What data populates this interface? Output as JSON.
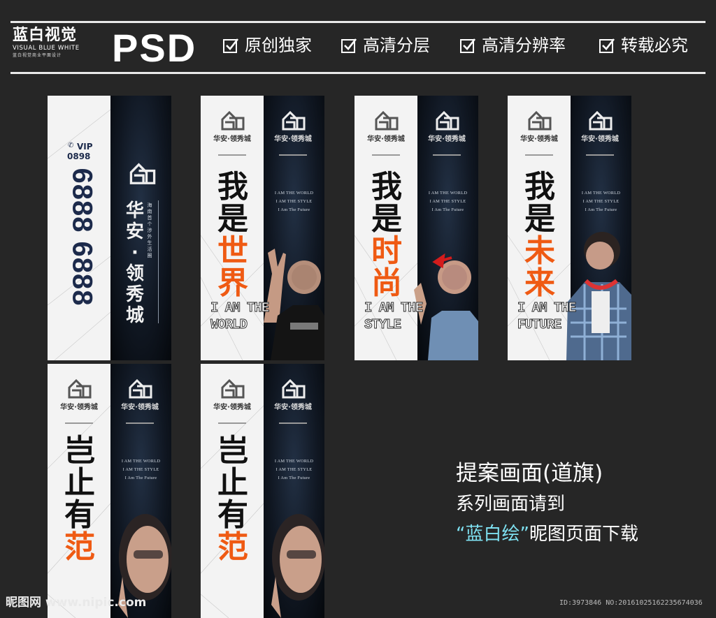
{
  "header": {
    "brand_title": "蓝白视觉",
    "brand_en": "VISUAL BLUE WHITE",
    "brand_sub": "蓝白视觉商业平面设计",
    "format_label": "PSD",
    "features": [
      "原创独家",
      "高清分层",
      "高清分辨率",
      "转载必究"
    ]
  },
  "project": {
    "name": "华安·领秀城",
    "name_vertical": "华安·领秀城",
    "tagline_vertical": "海南首个涉外生活圈",
    "tagline_lines": [
      "I AM THE WORLD",
      "I AM THE STYLE",
      "I Am The Future"
    ]
  },
  "banner_contact": {
    "vip_label": "VIP",
    "area_code": "0898",
    "phone": "6888 6888"
  },
  "banners": [
    {
      "headline_top": "我是",
      "headline_accent": "世界",
      "english": "I AM THE\nWORLD"
    },
    {
      "headline_top": "我是",
      "headline_accent": "时尚",
      "english": "I AM THE\nSTYLE"
    },
    {
      "headline_top": "我是",
      "headline_accent": "未来",
      "english": "I AM THE\nFUTURE"
    },
    {
      "headline_top": "岂止有",
      "headline_accent": "范"
    },
    {
      "headline_top": "岂止有",
      "headline_accent": "范"
    }
  ],
  "side_text": {
    "line1": "提案画面(道旗)",
    "line2": "系列画面请到",
    "line3_highlight": "“蓝白绘”",
    "line3_rest": "昵图页面下载"
  },
  "watermark": {
    "left": "昵图网 www.nipic.com",
    "right": "ID:3973846 NO:20161025162235674036"
  },
  "colors": {
    "background": "#262626",
    "accent_orange": "#ef5a13",
    "highlight_cyan": "#7ee0f0",
    "navy": "#1c2a4b"
  }
}
